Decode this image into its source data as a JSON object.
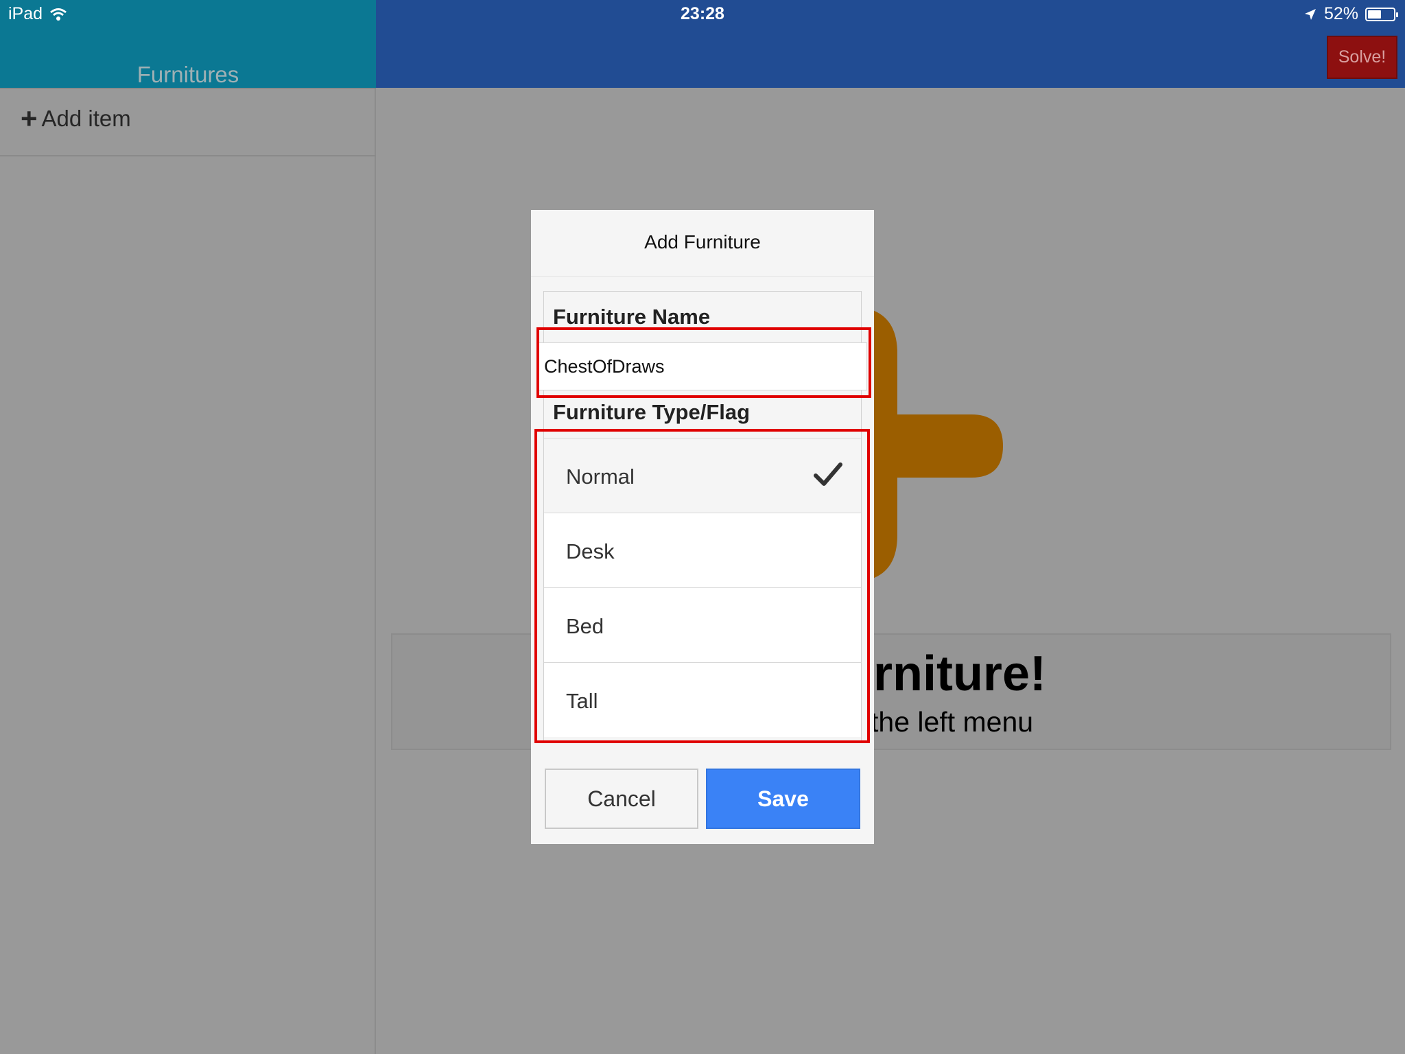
{
  "status_bar": {
    "device": "iPad",
    "time": "23:28",
    "battery": "52%",
    "battery_level": 0.52
  },
  "sidebar": {
    "title": "Furnitures",
    "add_item_label": "Add item"
  },
  "toolbar": {
    "solve_label": "Solve!"
  },
  "welcome": {
    "title": "ng Furniture!",
    "subtitle": "tem from the left menu"
  },
  "dialog": {
    "title": "Add Furniture",
    "name_label": "Furniture Name",
    "name_value": "ChestOfDraws",
    "type_label": "Furniture Type/Flag",
    "options": [
      {
        "label": "Normal",
        "selected": true
      },
      {
        "label": "Desk",
        "selected": false
      },
      {
        "label": "Bed",
        "selected": false
      },
      {
        "label": "Tall",
        "selected": false
      }
    ],
    "cancel_label": "Cancel",
    "save_label": "Save"
  },
  "colors": {
    "sidebar_header": "#0b7893",
    "main_header": "#214c93",
    "solve_button": "#8d1010",
    "save_button": "#3a82f6",
    "logo": "#9b5e00",
    "highlight": "#e00000"
  }
}
